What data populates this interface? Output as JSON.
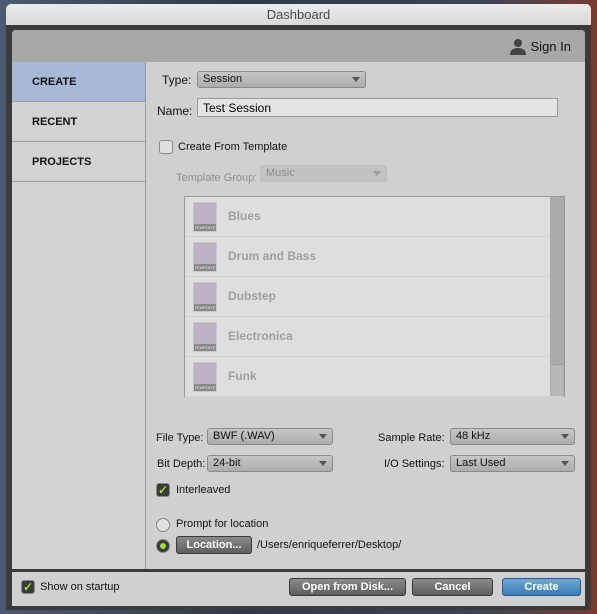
{
  "window": {
    "title": "Dashboard"
  },
  "header": {
    "sign_in": "Sign In"
  },
  "sidebar": {
    "items": [
      {
        "label": "CREATE",
        "selected": true
      },
      {
        "label": "RECENT"
      },
      {
        "label": "PROJECTS"
      }
    ]
  },
  "create": {
    "type_label": "Type:",
    "type_value": "Session",
    "name_label": "Name:",
    "name_value": "Test Session",
    "from_template_label": "Create From Template",
    "from_template_checked": false,
    "template_group_label": "Template Group:",
    "template_group_value": "Music",
    "templates": [
      "Blues",
      "Drum and Bass",
      "Dubstep",
      "Electronica",
      "Funk"
    ],
    "file_type_label": "File Type:",
    "file_type_value": "BWF (.WAV)",
    "sample_rate_label": "Sample Rate:",
    "sample_rate_value": "48 kHz",
    "bit_depth_label": "Bit Depth:",
    "bit_depth_value": "24-bit",
    "io_label": "I/O Settings:",
    "io_value": "Last Used",
    "interleaved_label": "Interleaved",
    "interleaved_checked": true,
    "prompt_label": "Prompt for location",
    "location_button": "Location...",
    "location_path": "/Users/enriqueferrer/Desktop/"
  },
  "footer": {
    "show_on_startup": "Show on startup",
    "open_from_disk": "Open from Disk...",
    "cancel": "Cancel",
    "create": "Create"
  },
  "colors": {
    "accent_check": "#9fe034",
    "selected_nav": "#a7b9d6",
    "primary_button": "#3b7cb4"
  }
}
